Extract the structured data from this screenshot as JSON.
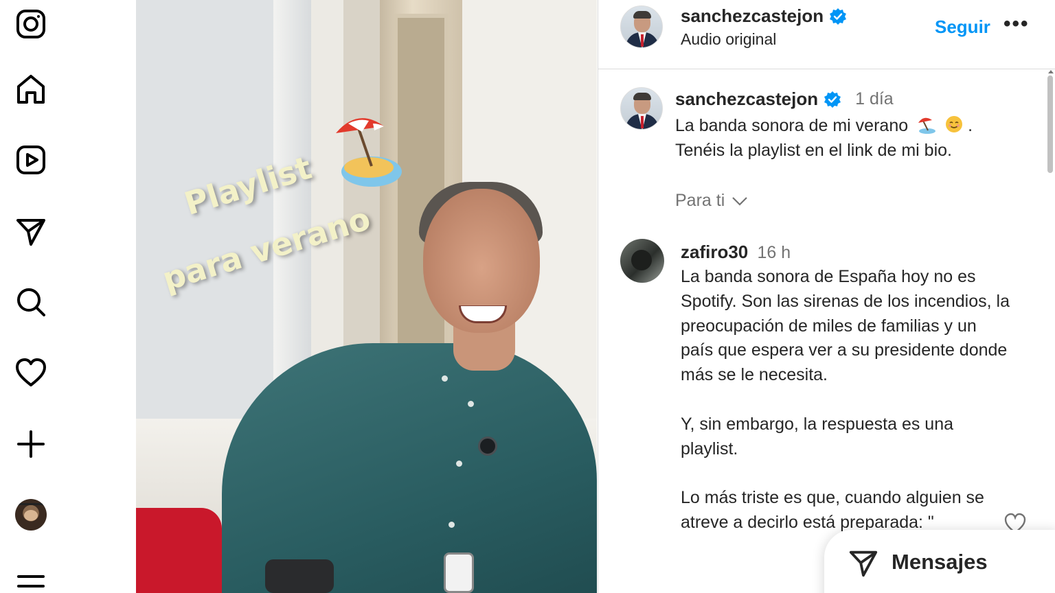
{
  "nav": {
    "items": [
      {
        "name": "instagram-logo-icon"
      },
      {
        "name": "home-icon"
      },
      {
        "name": "reels-icon"
      },
      {
        "name": "direct-send-icon"
      },
      {
        "name": "search-icon"
      },
      {
        "name": "heart-icon"
      },
      {
        "name": "plus-icon"
      },
      {
        "name": "profile-avatar"
      },
      {
        "name": "menu-icon"
      }
    ]
  },
  "video": {
    "overlay_line1": "Playlist",
    "overlay_line2": "para verano"
  },
  "header": {
    "username": "sanchezcastejon",
    "subtitle": "Audio original",
    "follow_label": "Seguir",
    "more_label": "•••"
  },
  "caption": {
    "username": "sanchezcastejon",
    "time": "1 día",
    "line1": "La banda sonora de mi verano",
    "line1_end": ".",
    "line2": "Tenéis la playlist en el link de mi bio."
  },
  "filter": {
    "label": "Para ti"
  },
  "comment": {
    "username": "zafiro30",
    "time": "16 h",
    "paragraph1": "La banda sonora de España hoy no es Spotify. Son las sirenas de los incendios, la preocupación de miles de familias y un país que espera ver a su presidente donde más se le necesita.",
    "paragraph2": "Y, sin embargo, la respuesta es una playlist.",
    "paragraph3": "Lo más triste es que, cuando alguien se atreve a decirlo está preparada: \""
  },
  "messages": {
    "label": "Mensajes"
  },
  "colors": {
    "accent": "#0095f6",
    "verified": "#0095f6",
    "text_primary": "#262626",
    "text_secondary": "#737373",
    "divider": "#dbdbdb"
  }
}
